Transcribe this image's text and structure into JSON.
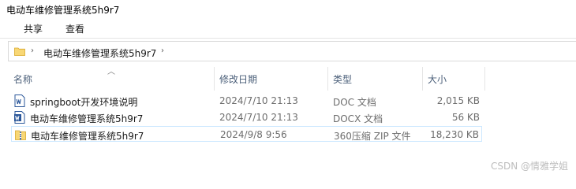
{
  "window": {
    "title": "电动车维修管理系统5h9r7"
  },
  "ribbon": {
    "tabs": [
      "共享",
      "查看"
    ]
  },
  "address": {
    "path": "电动车维修管理系统5h9r7"
  },
  "columns": {
    "name": "名称",
    "modified": "修改日期",
    "type": "类型",
    "size": "大小"
  },
  "files": [
    {
      "name": "springboot开发环境说明",
      "modified": "2024/7/10 21:13",
      "type": "DOC 文档",
      "size": "2,015 KB",
      "icon": "word-doc-icon"
    },
    {
      "name": "电动车维修管理系统5h9r7",
      "modified": "2024/7/10 21:13",
      "type": "DOCX 文档",
      "size": "56 KB",
      "icon": "word-docx-icon"
    },
    {
      "name": "电动车维修管理系统5h9r7",
      "modified": "2024/9/8 9:56",
      "type": "360压缩 ZIP 文件",
      "size": "18,230 KB",
      "icon": "zip-archive-icon"
    }
  ],
  "watermark": "CSDN @情雅学姐",
  "colors": {
    "header_text": "#4c607a",
    "selection_border": "#cce8ff",
    "word_blue": "#2b579a",
    "folder_yellow": "#f8d775"
  }
}
